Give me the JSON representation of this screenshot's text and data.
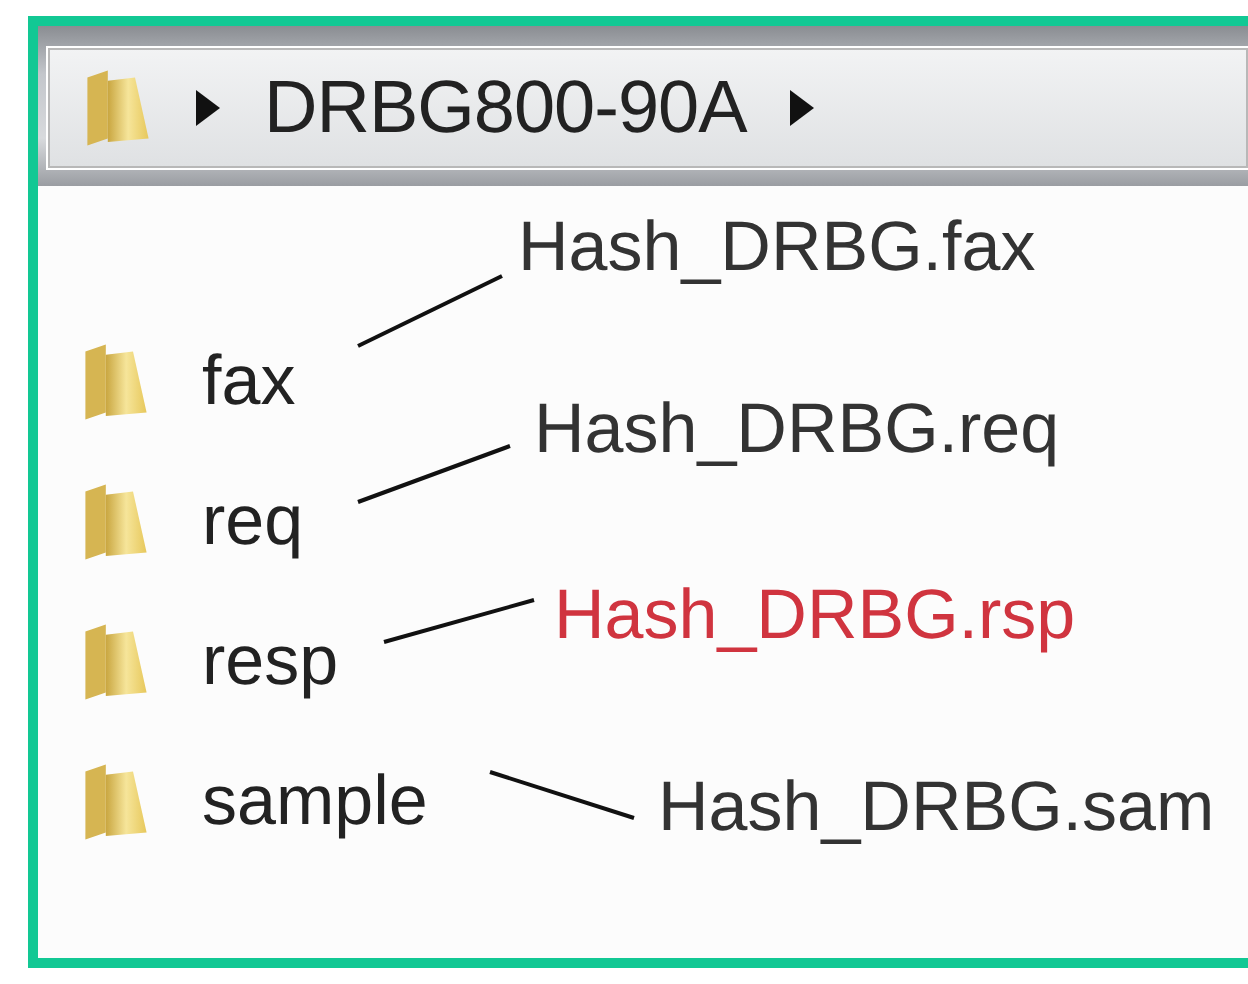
{
  "address_bar": {
    "crumbs": [
      {
        "label": "DRBG800-90A"
      }
    ]
  },
  "folders": [
    {
      "name": "fax"
    },
    {
      "name": "req"
    },
    {
      "name": "resp"
    },
    {
      "name": "sample"
    }
  ],
  "annotations": [
    {
      "text": "Hash_DRBG.fax",
      "color": "#333333"
    },
    {
      "text": "Hash_DRBG.req",
      "color": "#333333"
    },
    {
      "text": "Hash_DRBG.rsp",
      "color": "#d0343f"
    },
    {
      "text": "Hash_DRBG.sam",
      "color": "#333333"
    }
  ]
}
